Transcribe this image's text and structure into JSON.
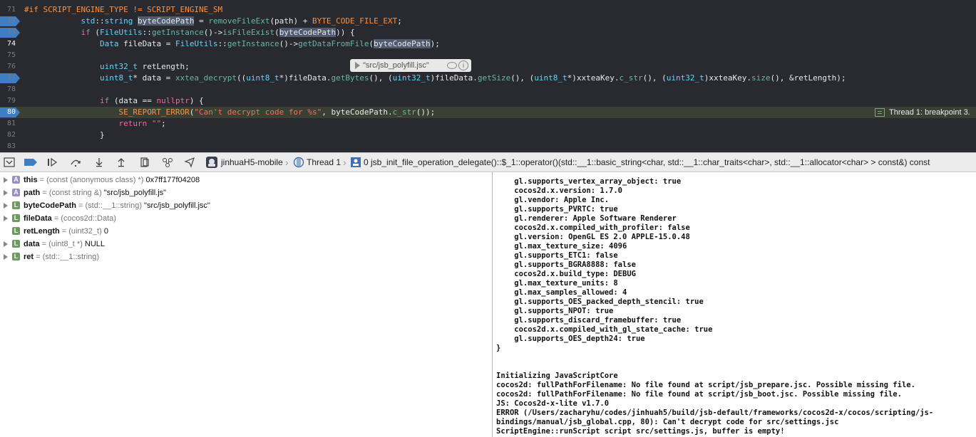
{
  "editor": {
    "lines": [
      {
        "num": "71",
        "bp": false,
        "hl": false,
        "segments": [
          [
            "pp",
            "#if SCRIPT_ENGINE_TYPE != SCRIPT_ENGINE_SM"
          ]
        ]
      },
      {
        "num": "72",
        "bp": true,
        "hl": false,
        "segments": [
          [
            "",
            "            "
          ],
          [
            "ty",
            "std"
          ],
          [
            "",
            "::"
          ],
          [
            "ty",
            "string"
          ],
          [
            "",
            " "
          ],
          [
            "sel",
            "byteCodePath"
          ],
          [
            "",
            " = "
          ],
          [
            "fn",
            "removeFileExt"
          ],
          [
            "",
            "(path) + "
          ],
          [
            "mac",
            "BYTE_CODE_FILE_EXT"
          ],
          [
            "",
            ";"
          ]
        ]
      },
      {
        "num": "73",
        "bp": true,
        "hl": false,
        "segments": [
          [
            "",
            "            "
          ],
          [
            "kw",
            "if"
          ],
          [
            "",
            " ("
          ],
          [
            "ty",
            "FileUtils"
          ],
          [
            "",
            "::"
          ],
          [
            "fn",
            "getInstance"
          ],
          [
            "",
            "()->"
          ],
          [
            "fn",
            "isFileExist"
          ],
          [
            "",
            "("
          ],
          [
            "sel",
            "byteCodePath"
          ],
          [
            "",
            ")) {"
          ]
        ]
      },
      {
        "num": "74",
        "bp": false,
        "hl": false,
        "active": true,
        "segments": [
          [
            "",
            "                "
          ],
          [
            "ty",
            "Data"
          ],
          [
            "",
            " fileData = "
          ],
          [
            "ty",
            "FileUtils"
          ],
          [
            "",
            "::"
          ],
          [
            "fn",
            "getInstance"
          ],
          [
            "",
            "()->"
          ],
          [
            "fn",
            "getDataFromFile"
          ],
          [
            "",
            "("
          ],
          [
            "sel",
            "byteCodePath"
          ],
          [
            "",
            ");"
          ]
        ]
      },
      {
        "num": "75",
        "bp": false,
        "hl": false,
        "segments": []
      },
      {
        "num": "76",
        "bp": false,
        "hl": false,
        "segments": [
          [
            "",
            "                "
          ],
          [
            "ty",
            "uint32_t"
          ],
          [
            "",
            " retLength;"
          ]
        ]
      },
      {
        "num": "77",
        "bp": true,
        "hl": false,
        "segments": [
          [
            "",
            "                "
          ],
          [
            "ty",
            "uint8_t"
          ],
          [
            "",
            "* data = "
          ],
          [
            "fn",
            "xxtea_decrypt"
          ],
          [
            "",
            "(("
          ],
          [
            "ty",
            "uint8_t"
          ],
          [
            "",
            "*)fileData."
          ],
          [
            "fn",
            "getBytes"
          ],
          [
            "",
            "(), ("
          ],
          [
            "ty",
            "uint32_t"
          ],
          [
            "",
            ")fileData."
          ],
          [
            "fn",
            "getSize"
          ],
          [
            "",
            "(), ("
          ],
          [
            "ty",
            "uint8_t"
          ],
          [
            "",
            "*)xxteaKey."
          ],
          [
            "fn",
            "c_str"
          ],
          [
            "",
            "(), ("
          ],
          [
            "ty",
            "uint32_t"
          ],
          [
            "",
            ")xxteaKey."
          ],
          [
            "fn",
            "size"
          ],
          [
            "",
            "(), &retLength);"
          ]
        ]
      },
      {
        "num": "78",
        "bp": false,
        "hl": false,
        "segments": []
      },
      {
        "num": "79",
        "bp": false,
        "hl": false,
        "segments": [
          [
            "",
            "                "
          ],
          [
            "kw",
            "if"
          ],
          [
            "",
            " (data == "
          ],
          [
            "kw",
            "nullptr"
          ],
          [
            "",
            ") {"
          ]
        ]
      },
      {
        "num": "80",
        "bp": true,
        "hl": true,
        "segments": [
          [
            "",
            "                    "
          ],
          [
            "mac",
            "SE_REPORT_ERROR"
          ],
          [
            "",
            "("
          ],
          [
            "str",
            "\"Can't decrypt code for %s\""
          ],
          [
            "",
            ", byteCodePath."
          ],
          [
            "fn",
            "c_str"
          ],
          [
            "",
            "());"
          ]
        ]
      },
      {
        "num": "81",
        "bp": false,
        "hl": false,
        "segments": [
          [
            "",
            "                    "
          ],
          [
            "kw",
            "return"
          ],
          [
            "",
            " "
          ],
          [
            "str",
            "\"\""
          ],
          [
            "",
            ";"
          ]
        ]
      },
      {
        "num": "82",
        "bp": false,
        "hl": false,
        "segments": [
          [
            "",
            "                }"
          ]
        ]
      },
      {
        "num": "83",
        "bp": false,
        "hl": false,
        "segments": []
      }
    ]
  },
  "tooltip": {
    "value": "\"src/jsb_polyfill.jsc\""
  },
  "breakpoint_label": "Thread 1: breakpoint 3.",
  "debugbar": {
    "target": "jinhuaH5-mobile",
    "thread": "Thread 1",
    "frame": "0 jsb_init_file_operation_delegate()::$_1::operator()(std::__1::basic_string<char, std::__1::char_traits<char>, std::__1::allocator<char> > const&) const"
  },
  "variables": [
    {
      "expand": true,
      "kind": "A",
      "name": "this",
      "type": "(const (anonymous class) *)",
      "value": "0x7ff177f04208"
    },
    {
      "expand": true,
      "kind": "A",
      "name": "path",
      "type": "(const string &)",
      "value": "\"src/jsb_polyfill.js\""
    },
    {
      "expand": true,
      "kind": "L",
      "name": "byteCodePath",
      "type": "(std::__1::string)",
      "value": "\"src/jsb_polyfill.jsc\""
    },
    {
      "expand": true,
      "kind": "L",
      "name": "fileData",
      "type": "(cocos2d::Data)",
      "value": ""
    },
    {
      "expand": false,
      "kind": "L",
      "name": "retLength",
      "type": "(uint32_t)",
      "value": "0"
    },
    {
      "expand": true,
      "kind": "L",
      "name": "data",
      "type": "(uint8_t *)",
      "value": "NULL"
    },
    {
      "expand": true,
      "kind": "L",
      "name": "ret",
      "type": "(std::__1::string)",
      "value": ""
    }
  ],
  "console": [
    "    gl.supports_vertex_array_object: true",
    "    cocos2d.x.version: 1.7.0",
    "    gl.vendor: Apple Inc.",
    "    gl.supports_PVRTC: true",
    "    gl.renderer: Apple Software Renderer",
    "    cocos2d.x.compiled_with_profiler: false",
    "    gl.version: OpenGL ES 2.0 APPLE-15.0.48",
    "    gl.max_texture_size: 4096",
    "    gl.supports_ETC1: false",
    "    gl.supports_BGRA8888: false",
    "    cocos2d.x.build_type: DEBUG",
    "    gl.max_texture_units: 8",
    "    gl.max_samples_allowed: 4",
    "    gl.supports_OES_packed_depth_stencil: true",
    "    gl.supports_NPOT: true",
    "    gl.supports_discard_framebuffer: true",
    "    cocos2d.x.compiled_with_gl_state_cache: true",
    "    gl.supports_OES_depth24: true",
    "}",
    "",
    "",
    "Initializing JavaScriptCore",
    "cocos2d: fullPathForFilename: No file found at script/jsb_prepare.jsc. Possible missing file.",
    "cocos2d: fullPathForFilename: No file found at script/jsb_boot.jsc. Possible missing file.",
    "JS: Cocos2d-x-lite v1.7.0",
    "ERROR (/Users/zacharyhu/codes/jinhuah5/build/jsb-default/frameworks/cocos2d-x/cocos/scripting/js-",
    "bindings/manual/jsb_global.cpp, 80): Can't decrypt code for src/settings.jsc",
    "ScriptEngine::runScript script src/settings.js, buffer is empty!"
  ]
}
